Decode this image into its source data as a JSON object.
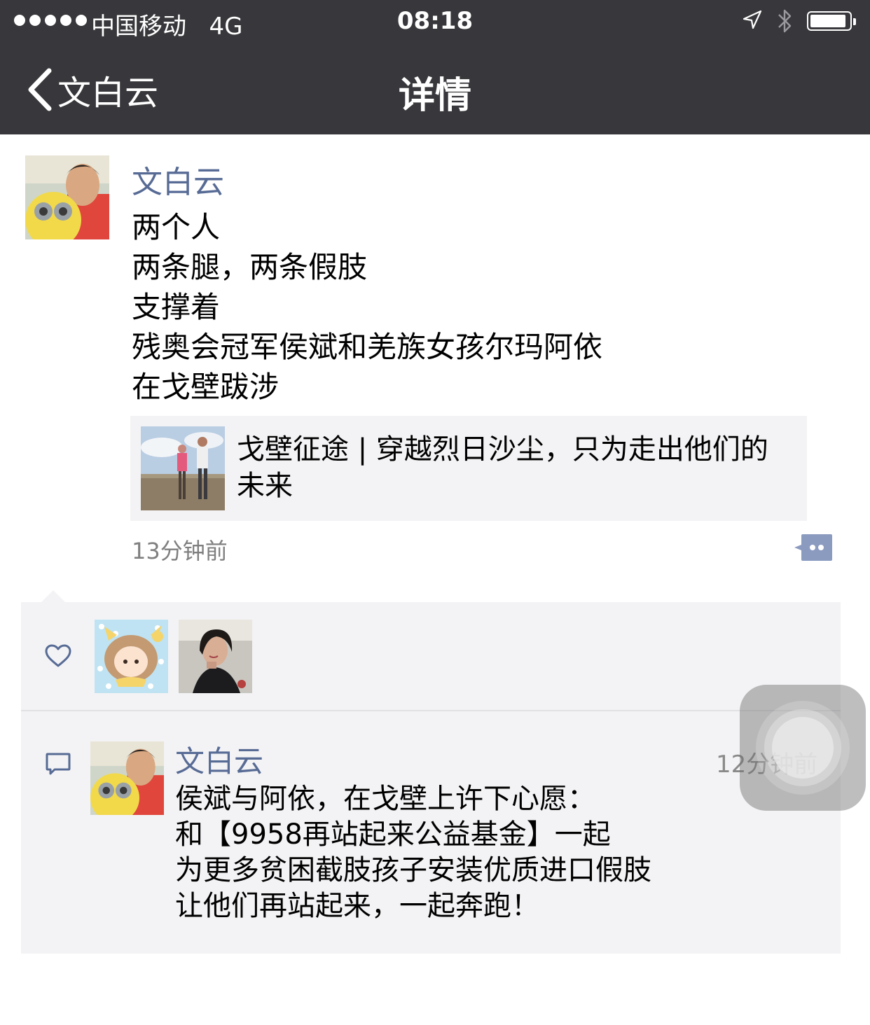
{
  "status_bar": {
    "carrier": "中国移动",
    "network": "4G",
    "time": "08:18"
  },
  "nav": {
    "back_label": "文白云",
    "title": "详情"
  },
  "post": {
    "author": "文白云",
    "lines": [
      "两个人",
      "两条腿，两条假肢",
      "支撑着",
      "残奥会冠军侯斌和羌族女孩尔玛阿依",
      "在戈壁跋涉"
    ],
    "link_title": "戈壁征途 | 穿越烈日沙尘，只为走出他们的未来",
    "time": "13分钟前"
  },
  "likes": {
    "icon": "heart-outline-icon",
    "users": [
      "liker-avatar-cartoon-girl",
      "liker-avatar-woman"
    ]
  },
  "comment": {
    "icon": "speech-bubble-icon",
    "author": "文白云",
    "time": "12分钟前",
    "lines": [
      "侯斌与阿依，在戈壁上许下心愿：",
      "和【9958再站起来公益基金】一起",
      "为更多贫困截肢孩子安装优质进口假肢",
      "让他们再站起来，一起奔跑！"
    ]
  },
  "colors": {
    "header_bg": "#38383c",
    "name_link": "#576b95",
    "panel_bg": "#f3f3f5",
    "time_gray": "#7f7f7f"
  }
}
